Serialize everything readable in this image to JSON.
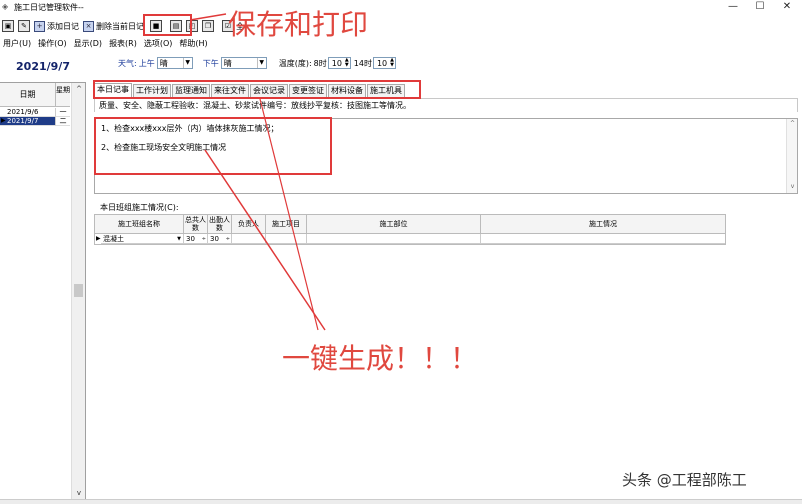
{
  "window": {
    "title": "施工日记管理软件--",
    "minimize_glyph": "—",
    "maximize_glyph": "☐",
    "close_glyph": "✕"
  },
  "toolbar": {
    "add_diary": "添加日记",
    "delete_current": "删除当前日记",
    "item3_partial": "全"
  },
  "menu": {
    "user": "用户(U)",
    "operate": "操作(O)",
    "display": "显示(D)",
    "report": "报表(R)",
    "options": "选项(O)",
    "help": "帮助(H)"
  },
  "weather": {
    "label": "天气:",
    "am_label": "上午",
    "am_value": "晴",
    "pm_label": "下午",
    "pm_value": "晴",
    "temp_label": "温度(度):",
    "t1_label": "8时",
    "t1_value": "10",
    "t2_label": "14时",
    "t2_value": "10"
  },
  "left": {
    "current_date": "2021/9/7",
    "col_date": "日期",
    "col_week": "星期",
    "rows": [
      {
        "date": "2021/9/6",
        "week": "一"
      },
      {
        "date": "2021/9/7",
        "week": "二"
      }
    ]
  },
  "tabs": [
    "本日记事",
    "工作计划",
    "监理通知",
    "来往文件",
    "会议记录",
    "变更签证",
    "材料设备",
    "施工机具"
  ],
  "hint": "质量、安全、隐蔽工程验收：混凝土、砂浆试件编号：放线抄平复核：技图施工等情况。",
  "editor": {
    "line1": "1、检查xxx楼xxx层外（内）墙体抹灰施工情况；",
    "line2": "2、检查施工现场安全文明施工情况"
  },
  "team_grid": {
    "title": "本日班组施工情况(C):",
    "headers": [
      "施工班组名称",
      "总共人数",
      "出勤人数",
      "负责人",
      "施工项目",
      "施工部位",
      "施工情况"
    ],
    "row": {
      "team": "混凝土",
      "total": "30",
      "present": "30"
    }
  },
  "annotations": {
    "save_print": "保存和打印",
    "one_click": "一键生成！！！"
  },
  "watermark": "头条 @工程部陈工"
}
